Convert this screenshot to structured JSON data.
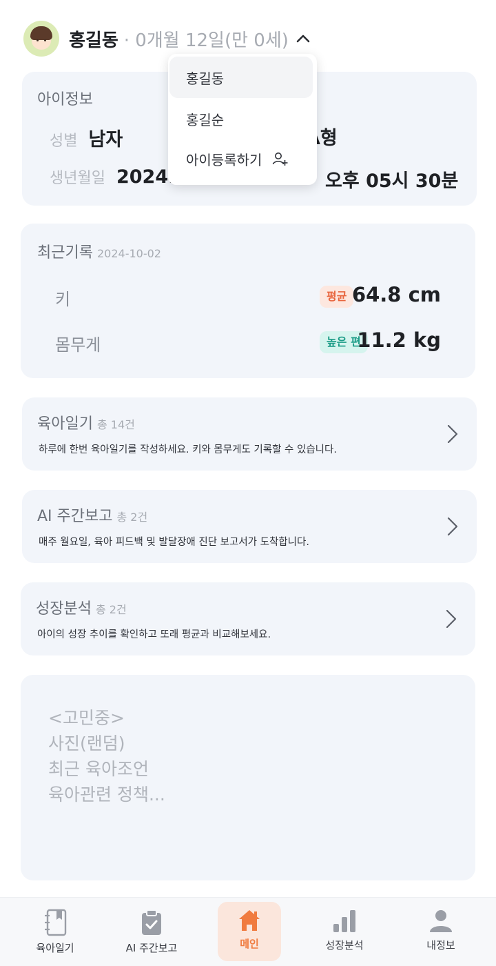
{
  "header": {
    "child_name": "홍길동",
    "age_text": "· 0개월 12일(만 0세)"
  },
  "dropdown": {
    "items": [
      "홍길동",
      "홍길순"
    ],
    "add_label": "아이등록하기"
  },
  "child_info": {
    "title": "아이정보",
    "gender_label": "성별",
    "gender_value": "남자",
    "blood_type_partial": "A형",
    "birth_label": "생년월일",
    "birth_value_partial": "2024.",
    "birth_time": "오후 05시 30분"
  },
  "recent_record": {
    "title": "최근기록",
    "date": "2024-10-02",
    "height_label": "키",
    "height_badge": "평균",
    "height_value": "64.8 cm",
    "weight_label": "몸무게",
    "weight_badge": "높은 편",
    "weight_value": "11.2 kg"
  },
  "links": [
    {
      "title": "육아일기",
      "count": "총 14건",
      "desc": "하루에 한번 육아일기를 작성하세요. 키와 몸무게도 기록할 수 있습니다."
    },
    {
      "title": "AI 주간보고",
      "count": "총 2건",
      "desc": "매주 월요일, 육아 피드백 및 발달장애 진단 보고서가 도착합니다."
    },
    {
      "title": "성장분석",
      "count": "총 2건",
      "desc": "아이의 성장 추이를 확인하고 또래 평균과 비교해보세요."
    }
  ],
  "placeholder": {
    "lines": [
      "<고민중>",
      "사진(랜덤)",
      "최근 육아조언",
      "육아관련 정책..."
    ]
  },
  "nav": {
    "items": [
      "육아일기",
      "AI 주간보고",
      "메인",
      "성장분석",
      "내정보"
    ],
    "active": "메인",
    "accent_color": "#f07b3f"
  }
}
